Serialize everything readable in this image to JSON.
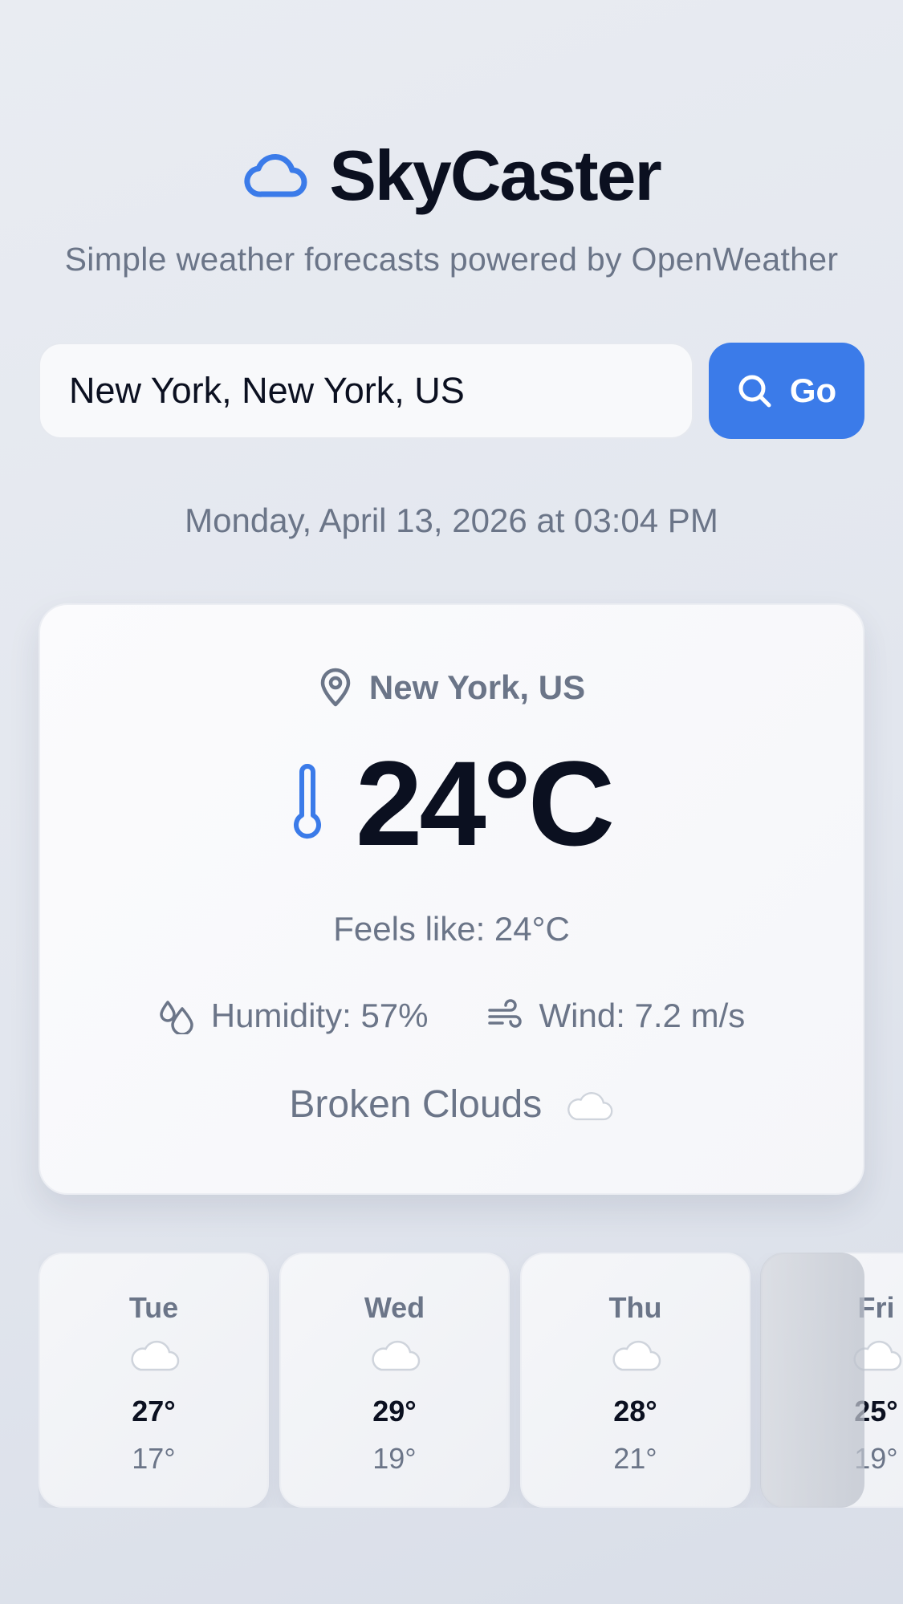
{
  "app": {
    "title": "SkyCaster",
    "subtitle": "Simple weather forecasts powered by OpenWeather",
    "logo_icon": "cloud-icon",
    "accent_color": "#3b7be9"
  },
  "search": {
    "value": "New York, New York, US",
    "button_label": "Go",
    "button_icon": "search-icon"
  },
  "datetime": "Monday, April 13, 2026 at 03:04 PM",
  "current": {
    "location": "New York, US",
    "location_icon": "map-pin-icon",
    "temperature": "24°C",
    "temperature_icon": "thermometer-icon",
    "feels_like": "Feels like: 24°C",
    "humidity": "Humidity: 57%",
    "humidity_icon": "droplets-icon",
    "wind": "Wind: 7.2 m/s",
    "wind_icon": "wind-icon",
    "condition": "Broken Clouds",
    "condition_icon": "cloud-emoji"
  },
  "forecast": [
    {
      "day": "Tue",
      "high": "27°",
      "low": "17°",
      "icon": "cloud-emoji"
    },
    {
      "day": "Wed",
      "high": "29°",
      "low": "19°",
      "icon": "cloud-emoji"
    },
    {
      "day": "Thu",
      "high": "28°",
      "low": "21°",
      "icon": "cloud-emoji"
    },
    {
      "day": "Fri",
      "high": "25°",
      "low": "19°",
      "icon": "cloud-emoji"
    }
  ]
}
